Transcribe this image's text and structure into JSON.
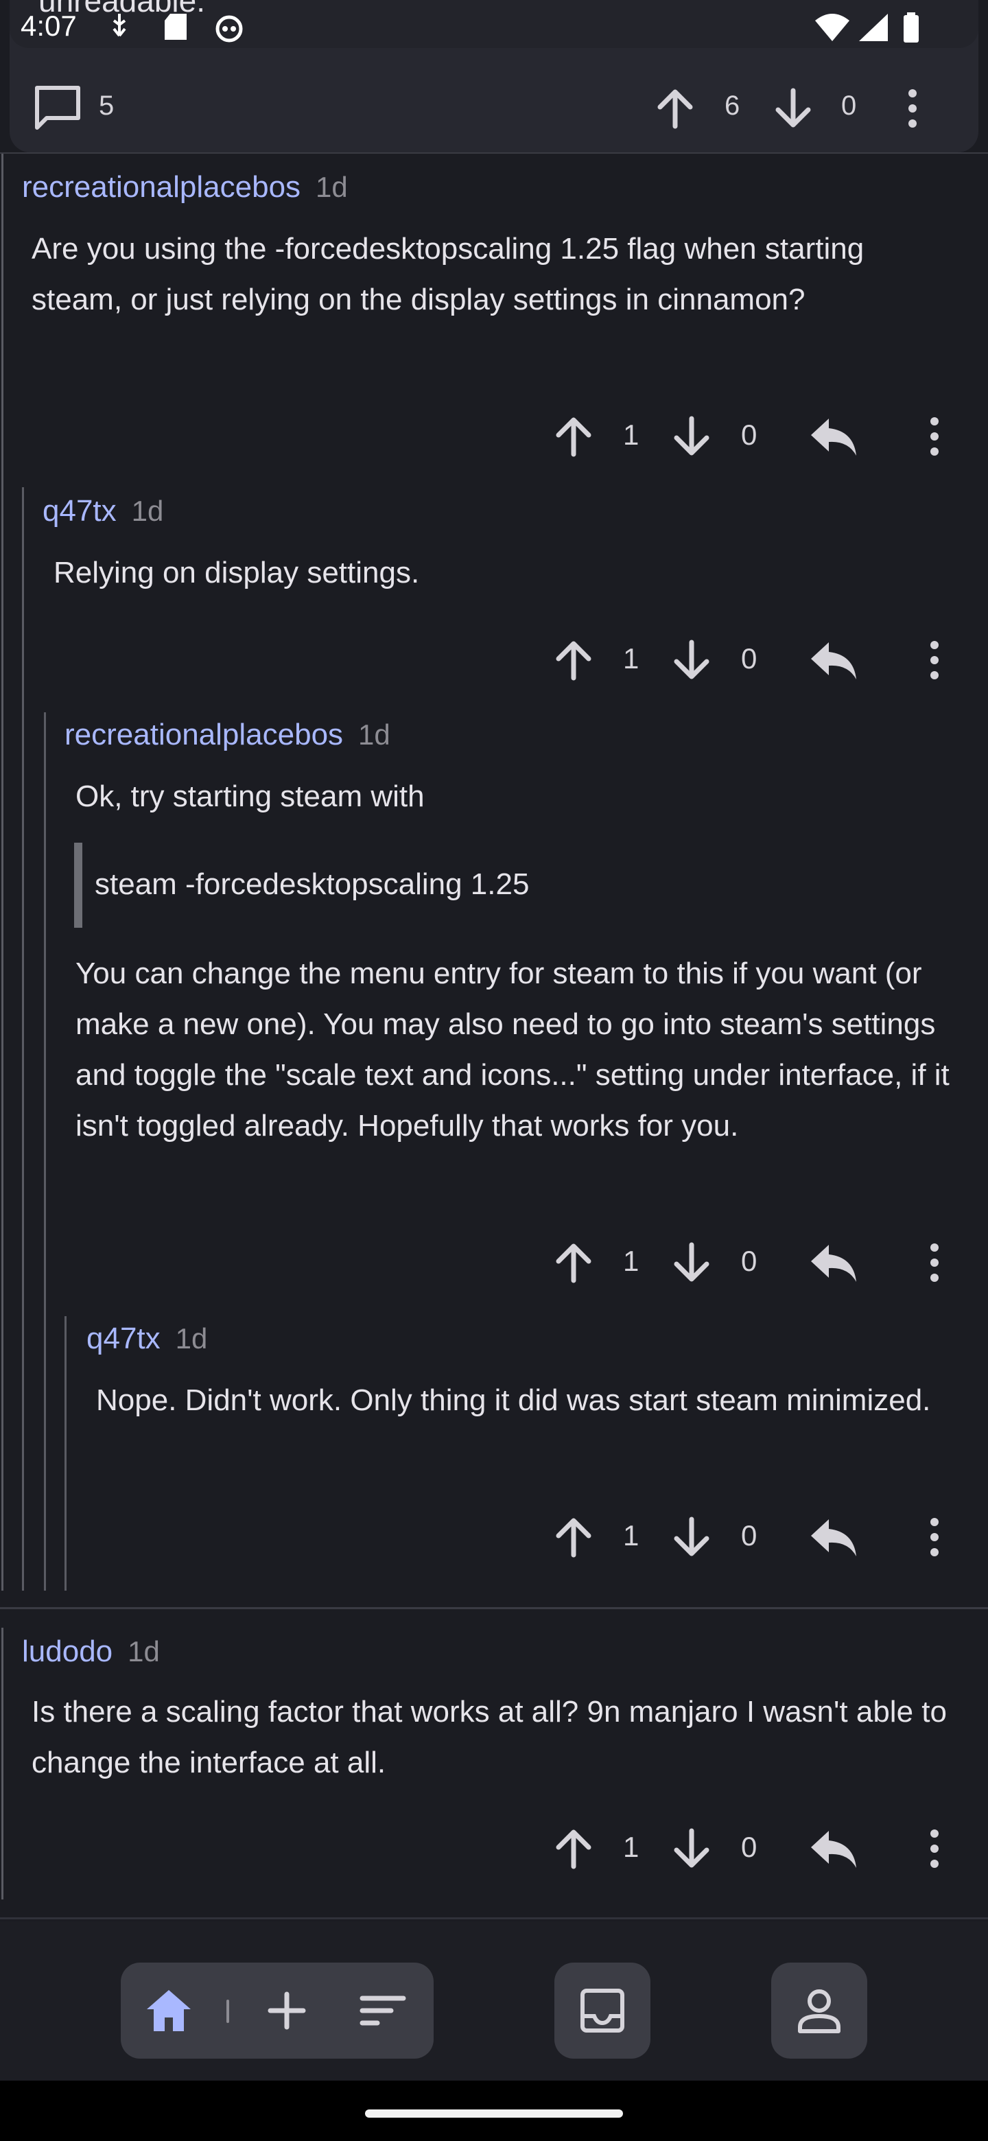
{
  "status_bar": {
    "time": "4:07"
  },
  "post": {
    "cut_text": "unreadable.",
    "comments_count": "5",
    "upvotes": "6",
    "downvotes": "0"
  },
  "comments": [
    {
      "user": "recreationalplacebos",
      "time": "1d",
      "body": "Are you using the -forcedesktopscaling 1.25 flag when starting steam, or just relying on the display settings in cinnamon?",
      "upvotes": "1",
      "downvotes": "0"
    },
    {
      "user": "q47tx",
      "time": "1d",
      "body": "Relying on display settings.",
      "upvotes": "1",
      "downvotes": "0"
    },
    {
      "user": "recreationalplacebos",
      "time": "1d",
      "body_intro": "Ok, try starting steam with",
      "quote": "steam -forcedesktopscaling 1.25",
      "body": "You can change the menu entry for steam to this if you want (or make a new one). You may also need to go into steam's settings and toggle the \"scale text and icons...\" setting under interface, if it isn't toggled already. Hopefully that works for you.",
      "upvotes": "1",
      "downvotes": "0"
    },
    {
      "user": "q47tx",
      "time": "1d",
      "body": "Nope. Didn't work. Only thing it did was start steam minimized.",
      "upvotes": "1",
      "downvotes": "0"
    },
    {
      "user": "ludodo",
      "time": "1d",
      "body": "Is there a scaling factor that works at all? 9n manjaro I wasn't able to change the interface at all.",
      "upvotes": "1",
      "downvotes": "0"
    }
  ],
  "icons": {
    "upvote": "arrow-up-icon",
    "downvote": "arrow-down-icon",
    "reply": "reply-icon",
    "more": "more-vert-icon",
    "comment": "comment-icon"
  },
  "colors": {
    "username": "#a9b8ff",
    "background": "#1b1c22",
    "accent": "#a9b8ff"
  }
}
